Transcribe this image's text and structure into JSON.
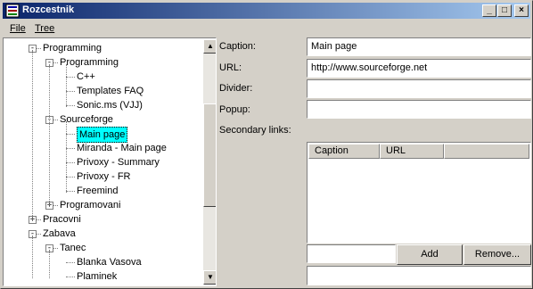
{
  "window": {
    "title": "Rozcestnik"
  },
  "titlebar_buttons": {
    "minimize": "_",
    "maximize": "□",
    "close": "×"
  },
  "menu": {
    "file": "File",
    "tree": "Tree"
  },
  "tree": {
    "nodes": [
      {
        "label": "Programming",
        "level": 0,
        "expander": "-"
      },
      {
        "label": "Programming",
        "level": 1,
        "expander": "-"
      },
      {
        "label": "C++",
        "level": 2,
        "expander": ""
      },
      {
        "label": "Templates FAQ",
        "level": 2,
        "expander": ""
      },
      {
        "label": "Sonic.ms (VJJ)",
        "level": 2,
        "expander": ""
      },
      {
        "label": "Sourceforge",
        "level": 1,
        "expander": "-"
      },
      {
        "label": "Main page",
        "level": 2,
        "expander": "",
        "selected": true
      },
      {
        "label": "Miranda - Main page",
        "level": 2,
        "expander": ""
      },
      {
        "label": "Privoxy - Summary",
        "level": 2,
        "expander": ""
      },
      {
        "label": "Privoxy - FR",
        "level": 2,
        "expander": ""
      },
      {
        "label": "Freemind",
        "level": 2,
        "expander": ""
      },
      {
        "label": "Programovani",
        "level": 1,
        "expander": "+"
      },
      {
        "label": "Pracovni",
        "level": 0,
        "expander": "+"
      },
      {
        "label": "Zabava",
        "level": 0,
        "expander": "-"
      },
      {
        "label": "Tanec",
        "level": 1,
        "expander": "-"
      },
      {
        "label": "Blanka Vasova",
        "level": 2,
        "expander": ""
      },
      {
        "label": "Plaminek",
        "level": 2,
        "expander": ""
      }
    ],
    "scroll_up": "▲",
    "scroll_down": "▼"
  },
  "form": {
    "caption_label": "Caption:",
    "caption_value": "Main page",
    "url_label": "URL:",
    "url_value": "http://www.sourceforge.net",
    "divider_label": "Divider:",
    "divider_value": "",
    "popup_label": "Popup:",
    "popup_value": "",
    "secondary_label": "Secondary links:"
  },
  "secondary_links": {
    "columns": [
      "Caption",
      "URL"
    ],
    "rows": []
  },
  "new_link_value": "",
  "bottom_value": "",
  "buttons": {
    "add": "Add",
    "remove": "Remove..."
  }
}
